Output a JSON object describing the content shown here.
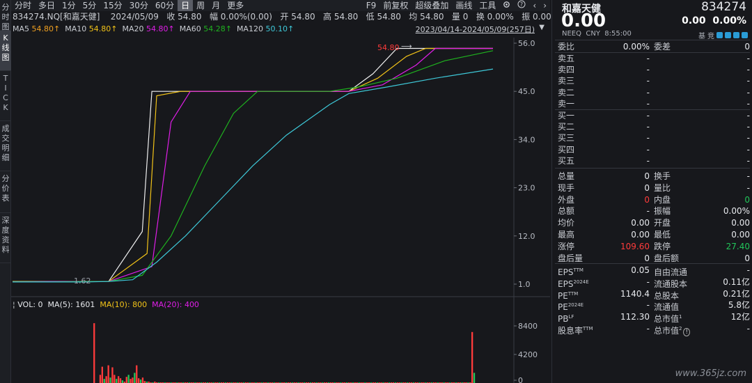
{
  "left_tabs": [
    "分\n时\n图",
    "K\n线\n图",
    "T\nI\nC\nK",
    "成\n交\n明\n细",
    "分\n价\n表",
    "深\n度\n资\n料"
  ],
  "toolbar": {
    "periods": [
      "分时",
      "多日",
      "1分",
      "5分",
      "15分",
      "30分",
      "60分",
      "日",
      "周",
      "月",
      "更多"
    ],
    "active_period": "日",
    "tools": [
      "F9",
      "前复权",
      "超级叠加",
      "画线",
      "工具"
    ]
  },
  "info_line": {
    "code": "834274.NQ[和嘉天健]",
    "date": "2024/05/09",
    "close": "收 54.80",
    "change": "幅 0.00%(0.00)",
    "open": "开 54.80",
    "high": "高 54.80",
    "low": "低 54.80",
    "avg": "均 54.80",
    "volume": "量 0",
    "turnover": "换 0.00%",
    "amplitude": "振 0.00%",
    "amount": "额 0"
  },
  "ma_line": {
    "ma5_label": "MA5",
    "ma5_value": "54.80↑",
    "ma10_label": "MA10",
    "ma10_value": "54.80↑",
    "ma20_label": "MA20",
    "ma20_value": "54.80↑",
    "ma60_label": "MA60",
    "ma60_value": "54.28↑",
    "ma120_label": "MA120",
    "ma120_value": "50.10↑",
    "range": "2023/04/14-2024/05/09(257日)"
  },
  "colors": {
    "ma5": "#f0f0f0",
    "ma10": "#f2c318",
    "ma20": "#e01ee8",
    "ma60": "#1fb31f",
    "ma120": "#3ec9d9",
    "up": "#ff3b3b",
    "down": "#21c65a"
  },
  "price_axis": {
    "ticks": [
      "56.0",
      "45.0",
      "34.0",
      "23.0",
      "12.0",
      "1.0"
    ]
  },
  "annotations": {
    "high_label": "54.80",
    "low_label": "1.62"
  },
  "volume_line": {
    "vol": "VOL: 0",
    "ma5": "MA(5): 1601",
    "ma10": "MA(10): 800",
    "ma20": "MA(20): 400"
  },
  "volume_axis": {
    "ticks": [
      "8400",
      "4200",
      "0"
    ]
  },
  "chart_data": {
    "type": "line",
    "title": "834274.NQ[和嘉天健]",
    "xlabel": "",
    "ylabel": "",
    "ylim": [
      1.0,
      56.0
    ],
    "x": [
      "2023/04/14",
      "2024/05/09"
    ],
    "series": [
      {
        "name": "MA5",
        "values": [
          1.6,
          1.6,
          1.6,
          1.6,
          13.0,
          45.0,
          45.0,
          45.0,
          45.0,
          45.0,
          45.0,
          49.0,
          54.8,
          54.8,
          54.8
        ]
      },
      {
        "name": "MA10",
        "values": [
          1.6,
          1.6,
          1.6,
          1.6,
          8.0,
          44.0,
          45.0,
          45.0,
          45.0,
          45.0,
          45.0,
          48.0,
          53.0,
          54.8,
          54.8
        ]
      },
      {
        "name": "MA20",
        "values": [
          1.5,
          1.6,
          1.6,
          1.6,
          5.0,
          38.0,
          45.0,
          45.0,
          45.0,
          45.0,
          45.0,
          46.5,
          51.0,
          54.8,
          54.8
        ]
      },
      {
        "name": "MA60",
        "values": [
          1.5,
          1.5,
          1.6,
          1.6,
          3.0,
          12.0,
          28.0,
          40.0,
          45.0,
          45.0,
          45.0,
          46.0,
          48.0,
          52.0,
          54.28
        ]
      },
      {
        "name": "MA120",
        "values": [
          1.5,
          1.5,
          1.5,
          1.6,
          2.0,
          6.0,
          12.0,
          20.0,
          28.0,
          35.0,
          42.0,
          44.5,
          46.0,
          48.0,
          50.1
        ]
      }
    ],
    "volume": {
      "ylim": [
        0,
        8400
      ],
      "bars": [
        0,
        0,
        0,
        0,
        0,
        0,
        0,
        0,
        0,
        0,
        0,
        0,
        0,
        0,
        0,
        0,
        0,
        0,
        0,
        0,
        0,
        0,
        0,
        0,
        0,
        0,
        0,
        0,
        0,
        0,
        0,
        0,
        0,
        0,
        0,
        0,
        0,
        0,
        0,
        0,
        8800,
        0,
        0,
        1200,
        2400,
        600,
        1000,
        2600,
        800,
        2300,
        1200,
        600,
        1000,
        700,
        400,
        200,
        900,
        1200,
        600,
        800,
        1500,
        2600,
        700,
        500,
        800,
        300,
        200,
        200,
        100,
        100,
        200,
        100,
        100,
        100,
        100,
        100,
        100,
        100,
        100,
        100,
        100,
        100,
        100,
        100,
        100,
        100,
        100,
        100,
        100,
        100,
        100,
        100,
        100,
        100,
        100,
        100,
        100,
        100,
        100,
        100,
        100,
        100,
        100,
        100,
        100,
        100,
        100,
        100,
        100,
        100,
        100,
        100,
        100,
        100,
        100,
        100,
        100,
        100,
        100,
        100,
        100,
        100,
        100,
        100,
        100,
        100,
        100,
        100,
        100,
        100,
        100,
        100,
        100,
        100,
        100,
        100,
        100,
        100,
        100,
        100,
        100,
        100,
        100,
        100,
        100,
        100,
        100,
        100,
        100,
        100,
        100,
        100,
        100,
        100,
        100,
        100,
        100,
        100,
        100,
        100,
        100,
        100,
        100,
        100,
        100,
        100,
        100,
        100,
        100,
        100,
        100,
        100,
        100,
        100,
        100,
        100,
        100,
        100,
        100,
        100,
        100,
        100,
        100,
        100,
        100,
        100,
        100,
        100,
        100,
        100,
        100,
        100,
        100,
        100,
        100,
        100,
        100,
        100,
        100,
        100,
        100,
        100,
        100,
        100,
        100,
        100,
        100,
        100,
        100,
        100,
        100,
        100,
        100,
        100,
        100,
        100,
        100,
        100,
        100,
        100,
        100,
        100,
        100,
        100,
        100,
        100,
        100,
        7500,
        1500,
        0,
        0,
        0,
        0,
        0,
        0,
        0,
        0,
        0,
        0,
        0,
        0,
        0,
        0,
        0,
        0,
        0,
        0,
        0
      ]
    }
  },
  "quote": {
    "name": "和嘉天健",
    "code": "834274",
    "price": "0.00",
    "change": "0.00",
    "change_pct": "0.00%",
    "market": "NEEQ",
    "currency": "CNY",
    "time": "8:55:00",
    "tabs": [
      "基",
      "竞"
    ]
  },
  "order_book": {
    "wei_bi_label": "委比",
    "wei_bi": "0.00%",
    "wei_cha_label": "委差",
    "wei_cha": "0",
    "asks": [
      {
        "label": "卖五",
        "price": "-",
        "vol": "-"
      },
      {
        "label": "卖四",
        "price": "-",
        "vol": "-"
      },
      {
        "label": "卖三",
        "price": "-",
        "vol": "-"
      },
      {
        "label": "卖二",
        "price": "-",
        "vol": "-"
      },
      {
        "label": "卖一",
        "price": "-",
        "vol": "-"
      }
    ],
    "bids": [
      {
        "label": "买一",
        "price": "-",
        "vol": "-"
      },
      {
        "label": "买二",
        "price": "-",
        "vol": "-"
      },
      {
        "label": "买三",
        "price": "-",
        "vol": "-"
      },
      {
        "label": "买四",
        "price": "-",
        "vol": "-"
      },
      {
        "label": "买五",
        "price": "-",
        "vol": "-"
      }
    ]
  },
  "stats": [
    {
      "l1": "总量",
      "v1": "0",
      "c1": "white",
      "l2": "换手",
      "v2": "-",
      "c2": "white"
    },
    {
      "l1": "现手",
      "v1": "0",
      "c1": "white",
      "l2": "量比",
      "v2": "-",
      "c2": "white"
    },
    {
      "l1": "外盘",
      "v1": "0",
      "c1": "red",
      "l2": "内盘",
      "v2": "0",
      "c2": "green"
    },
    {
      "l1": "总额",
      "v1": "-",
      "c1": "white",
      "l2": "振幅",
      "v2": "0.00%",
      "c2": "white"
    },
    {
      "l1": "均价",
      "v1": "0.00",
      "c1": "white",
      "l2": "开盘",
      "v2": "0.00",
      "c2": "white"
    },
    {
      "l1": "最高",
      "v1": "0.00",
      "c1": "white",
      "l2": "最低",
      "v2": "0.00",
      "c2": "white"
    },
    {
      "l1": "涨停",
      "v1": "109.60",
      "c1": "red",
      "l2": "跌停",
      "v2": "27.40",
      "c2": "green"
    },
    {
      "l1": "盘后量",
      "v1": "0",
      "c1": "white",
      "l2": "盘后额",
      "v2": "0",
      "c2": "white"
    }
  ],
  "fundamentals": [
    {
      "l1": "EPS",
      "s1": "TTM",
      "v1": "0.05",
      "l2": "自由流通",
      "s2": "",
      "v2": "-"
    },
    {
      "l1": "EPS",
      "s1": "2024E",
      "v1": "-",
      "l2": "流通股本",
      "s2": "",
      "v2": "0.11亿"
    },
    {
      "l1": "PE",
      "s1": "TTM",
      "v1": "1140.4",
      "l2": "总股本",
      "s2": "",
      "v2": "0.21亿"
    },
    {
      "l1": "PE",
      "s1": "2024E",
      "v1": "-",
      "l2": "流通值",
      "s2": "",
      "v2": "5.8亿"
    },
    {
      "l1": "PB",
      "s1": "LF",
      "v1": "112.30",
      "l2": "总市值",
      "s2": "1",
      "v2": "12亿"
    },
    {
      "l1": "股息率",
      "s1": "TTM",
      "v1": "-",
      "l2": "总市值",
      "s2": "2",
      "v2": "-"
    }
  ],
  "watermark": "www.365jz.com"
}
